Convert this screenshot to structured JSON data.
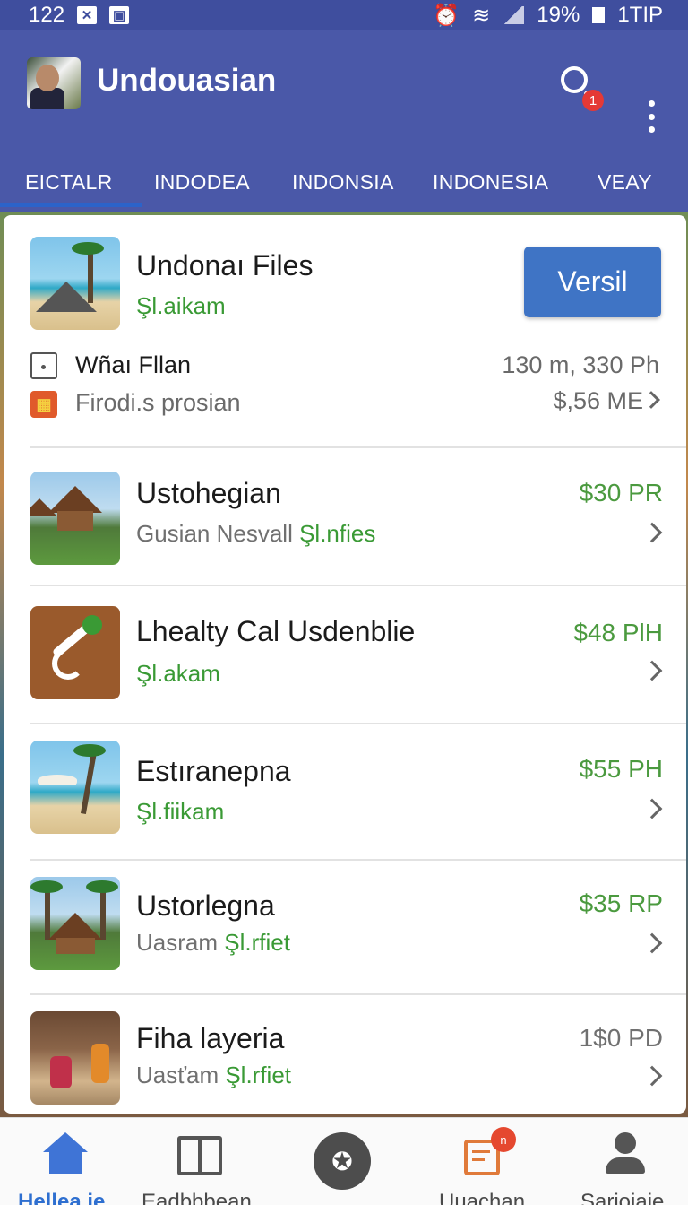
{
  "status_bar": {
    "time": "122",
    "left_icons": [
      "x-box-icon",
      "image-icon"
    ],
    "battery": "19%",
    "network": "1TIP"
  },
  "app_bar": {
    "title": "Undouasian",
    "notification_count": "1",
    "colors": {
      "bar": "#4a58a8",
      "accent": "#3f74c5",
      "price_green": "#4b9a3f"
    }
  },
  "tabs": [
    "EICTALR",
    "INDODEA",
    "INDONSIA",
    "INDONESIA",
    "VEAY"
  ],
  "featured": {
    "title": "Undonaı Files",
    "subtitle": "Şl.aikam",
    "button_label": "Versil",
    "info": [
      {
        "label": "Wñaı Fllan",
        "value": "130 m, 330 Ph",
        "icon": "square-dot-icon"
      },
      {
        "label": "Firodi.s prosian",
        "value": "$,56 ME",
        "icon": "calendar-icon"
      }
    ]
  },
  "listings": [
    {
      "title": "Ustohegian",
      "sub_gray": "Gusian Nesvall ",
      "sub_green": "Şl.nfies",
      "price": "$30 PR",
      "thumb": "hut-thumb"
    },
    {
      "title": "Lhealty Cal Usdenblie",
      "sub_gray": "",
      "sub_green": "Şl.akam",
      "price": "$48 PlH",
      "thumb": "satellite-thumb"
    },
    {
      "title": "Estıranepna",
      "sub_gray": "",
      "sub_green": "Şl.fiikam",
      "price": "$55 PH",
      "thumb": "beach-thumb"
    },
    {
      "title": "Ustorlegna",
      "sub_gray": "Uasram ",
      "sub_green": "Şl.rfiet",
      "price": "$35 RP",
      "thumb": "hut-thumb"
    },
    {
      "title": "Fiha layeria",
      "sub_gray": "Uasťam ",
      "sub_green": "Şl.rfiet",
      "price": "1$0 PD",
      "thumb": "people-thumb"
    }
  ],
  "bottom_nav": [
    {
      "label": "Hellea.ie",
      "icon": "home-icon"
    },
    {
      "label": "Eadbbbean",
      "icon": "book-icon"
    },
    {
      "label": "",
      "icon": "compass-icon"
    },
    {
      "label": "Uuachan",
      "icon": "message-icon",
      "badge": "n"
    },
    {
      "label": "Sarioiaie",
      "icon": "user-icon"
    }
  ]
}
